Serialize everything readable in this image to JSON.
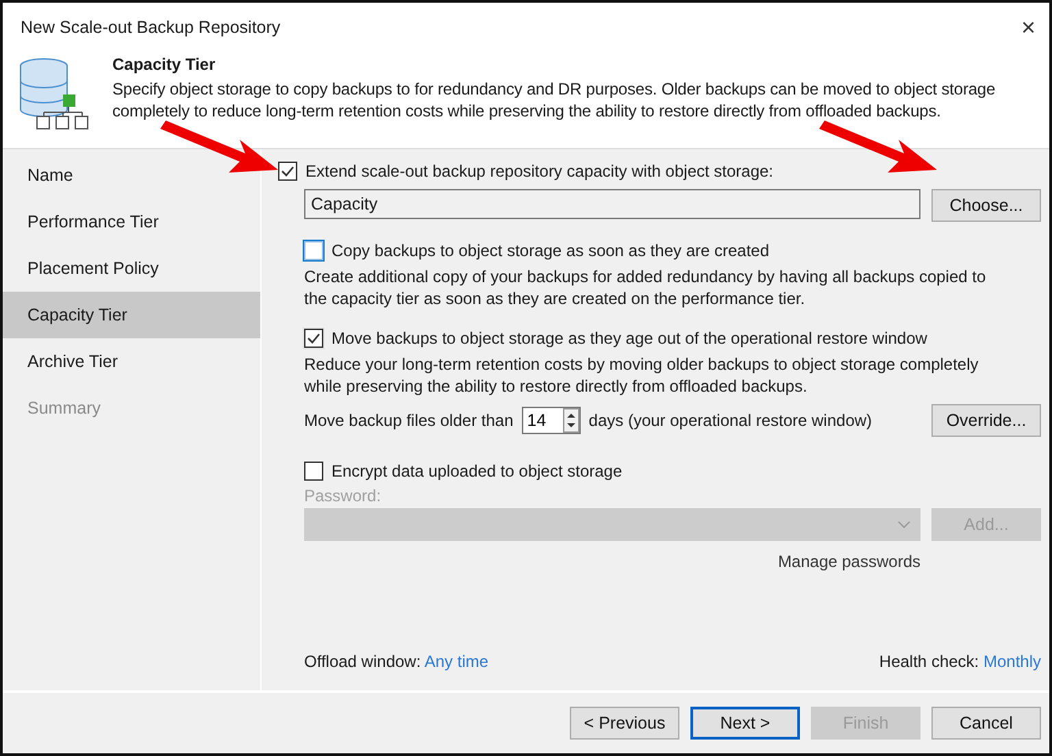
{
  "window": {
    "title": "New Scale-out Backup Repository",
    "close": "×"
  },
  "header": {
    "title": "Capacity Tier",
    "description": "Specify object storage to copy backups to for redundancy and DR purposes. Older backups can be moved to object storage completely to reduce long-term retention costs while preserving the ability to restore directly from offloaded backups."
  },
  "steps": [
    {
      "label": "Name",
      "selected": false,
      "disabled": false
    },
    {
      "label": "Performance Tier",
      "selected": false,
      "disabled": false
    },
    {
      "label": "Placement Policy",
      "selected": false,
      "disabled": false
    },
    {
      "label": "Capacity Tier",
      "selected": true,
      "disabled": false
    },
    {
      "label": "Archive Tier",
      "selected": false,
      "disabled": false
    },
    {
      "label": "Summary",
      "selected": false,
      "disabled": true
    }
  ],
  "extend": {
    "label": "Extend scale-out backup repository capacity with object storage:",
    "checked": true,
    "value": "Capacity",
    "button": "Choose..."
  },
  "options": [
    {
      "label": "Copy backups to object storage as soon as they are created",
      "checked": false,
      "focused": true,
      "description": "Create additional copy of your backups for added redundancy by having all backups copied to the capacity tier as soon as they are created on the performance tier."
    },
    {
      "label": "Move backups to object storage as they age out of the operational restore window",
      "checked": true,
      "focused": false,
      "description": "Reduce your long-term retention costs by moving older backups to object storage completely while preserving the ability to restore directly from offloaded backups.",
      "retention": {
        "prefix": "Move backup files older than",
        "value": "14",
        "suffix": "days (your operational restore window)",
        "button": "Override..."
      }
    }
  ],
  "encrypt": {
    "label": "Encrypt data uploaded to object storage",
    "checked": false,
    "password_label": "Password:",
    "button": "Add...",
    "link": "Manage passwords"
  },
  "footer": {
    "offload_label": "Offload window:",
    "offload_value": "Any time",
    "health_label": "Health check:",
    "health_value": "Monthly"
  },
  "buttons": [
    {
      "label": "< Previous",
      "kind": "normal"
    },
    {
      "label": "Next >",
      "kind": "default"
    },
    {
      "label": "Finish",
      "kind": "disabled"
    },
    {
      "label": "Cancel",
      "kind": "normal"
    }
  ]
}
